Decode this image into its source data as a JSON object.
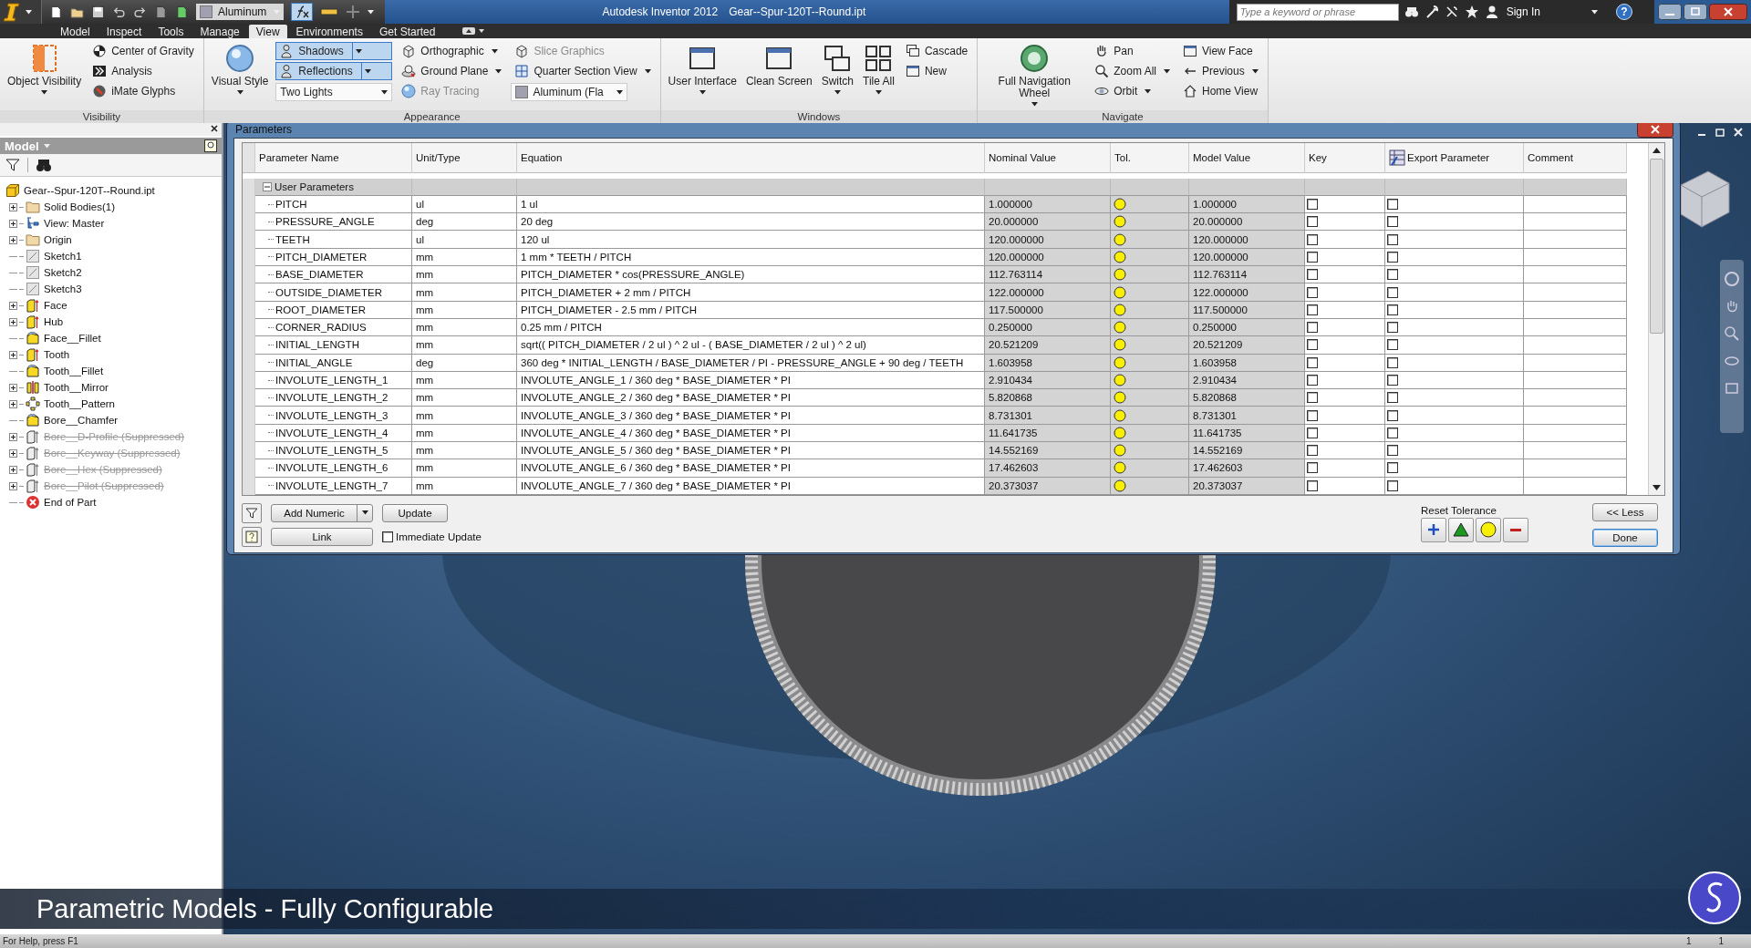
{
  "title_bar": {
    "product": "Autodesk Inventor 2012",
    "file": "Gear--Spur-120T--Round.ipt",
    "material": "Aluminum",
    "search_placeholder": "Type a keyword or phrase",
    "sign_in": "Sign In",
    "help": "?"
  },
  "ribbon_tabs": [
    {
      "label": "Model",
      "selected": false
    },
    {
      "label": "Inspect",
      "selected": false
    },
    {
      "label": "Tools",
      "selected": false
    },
    {
      "label": "Manage",
      "selected": false
    },
    {
      "label": "View",
      "selected": true
    },
    {
      "label": "Environments",
      "selected": false
    },
    {
      "label": "Get Started",
      "selected": false
    }
  ],
  "ribbon_panels": [
    {
      "title": "Visibility",
      "columns": [
        [
          {
            "label": "Object Visibility",
            "kind": "large",
            "menu": true,
            "disabled": false
          }
        ],
        [
          {
            "label": "Center of Gravity",
            "kind": "small",
            "menu": false,
            "disabled": false
          },
          {
            "label": "Analysis",
            "kind": "small",
            "menu": false,
            "disabled": false
          },
          {
            "label": "iMate Glyphs",
            "kind": "small",
            "menu": false,
            "disabled": false
          }
        ]
      ]
    },
    {
      "title": "Appearance",
      "columns": [
        [
          {
            "label": "Visual Style",
            "kind": "large",
            "menu": true,
            "disabled": false
          }
        ],
        [
          {
            "label": "Shadows",
            "kind": "toggle",
            "on": true,
            "menu": true,
            "disabled": false
          },
          {
            "label": "Reflections",
            "kind": "toggle",
            "on": true,
            "menu": true,
            "disabled": false
          },
          {
            "label": "Two Lights",
            "kind": "select",
            "menu": true,
            "disabled": false
          }
        ],
        [
          {
            "label": "Orthographic",
            "kind": "small",
            "menu": true,
            "disabled": false
          },
          {
            "label": "Ground Plane",
            "kind": "small",
            "menu": true,
            "disabled": false
          },
          {
            "label": "Ray Tracing",
            "kind": "small",
            "menu": false,
            "disabled": true
          }
        ],
        [
          {
            "label": "Slice Graphics",
            "kind": "small",
            "menu": false,
            "disabled": true
          },
          {
            "label": "Quarter Section View",
            "kind": "small",
            "menu": true,
            "disabled": false
          },
          {
            "label": "Aluminum (Fla",
            "kind": "select",
            "menu": true,
            "disabled": false
          }
        ]
      ]
    },
    {
      "title": "Windows",
      "columns": [
        [
          {
            "label": "User Interface",
            "kind": "large",
            "menu": true,
            "disabled": false
          }
        ],
        [
          {
            "label": "Clean Screen",
            "kind": "large",
            "menu": false,
            "disabled": false
          }
        ],
        [
          {
            "label": "Switch",
            "kind": "large",
            "menu": true,
            "disabled": false
          }
        ],
        [
          {
            "label": "Tile All",
            "kind": "large",
            "menu": true,
            "disabled": false
          }
        ],
        [
          {
            "label": "Cascade",
            "kind": "small",
            "menu": false,
            "disabled": false
          },
          {
            "label": "New",
            "kind": "small",
            "menu": false,
            "disabled": false
          }
        ]
      ]
    },
    {
      "title": "Navigate",
      "columns": [
        [
          {
            "label": "Full Navigation Wheel",
            "kind": "large",
            "menu": true,
            "disabled": false
          }
        ],
        [
          {
            "label": "Pan",
            "kind": "small",
            "menu": false,
            "disabled": false
          },
          {
            "label": "Zoom All",
            "kind": "small",
            "menu": true,
            "disabled": false
          },
          {
            "label": "Orbit",
            "kind": "small",
            "menu": true,
            "disabled": false
          }
        ],
        [
          {
            "label": "View Face",
            "kind": "small",
            "menu": false,
            "disabled": false
          },
          {
            "label": "Previous",
            "kind": "small",
            "menu": true,
            "disabled": false
          },
          {
            "label": "Home View",
            "kind": "small",
            "menu": false,
            "disabled": false
          }
        ]
      ]
    }
  ],
  "browser": {
    "title": "Model",
    "tree": [
      {
        "label": "Gear--Spur-120T--Round.ipt",
        "kind": "part",
        "suppressed": false,
        "children": [
          {
            "label": "Solid Bodies(1)",
            "kind": "bodies",
            "expandable": true,
            "suppressed": false
          },
          {
            "label": "View: Master",
            "kind": "view",
            "expandable": true,
            "suppressed": false
          },
          {
            "label": "Origin",
            "kind": "folder",
            "expandable": true,
            "suppressed": false
          },
          {
            "label": "Sketch1",
            "kind": "sketch",
            "expandable": false,
            "suppressed": false
          },
          {
            "label": "Sketch2",
            "kind": "sketch",
            "expandable": false,
            "suppressed": false
          },
          {
            "label": "Sketch3",
            "kind": "sketch",
            "expandable": false,
            "suppressed": false
          },
          {
            "label": "Face",
            "kind": "extrude",
            "expandable": true,
            "suppressed": false
          },
          {
            "label": "Hub",
            "kind": "extrude",
            "expandable": true,
            "suppressed": false
          },
          {
            "label": "Face__Fillet",
            "kind": "fillet",
            "expandable": false,
            "suppressed": false
          },
          {
            "label": "Tooth",
            "kind": "extrude",
            "expandable": true,
            "suppressed": false
          },
          {
            "label": "Tooth__Fillet",
            "kind": "fillet",
            "expandable": false,
            "suppressed": false
          },
          {
            "label": "Tooth__Mirror",
            "kind": "mirror",
            "expandable": true,
            "suppressed": false
          },
          {
            "label": "Tooth__Pattern",
            "kind": "pattern",
            "expandable": true,
            "suppressed": false
          },
          {
            "label": "Bore__Chamfer",
            "kind": "fillet",
            "expandable": false,
            "suppressed": false
          },
          {
            "label": "Bore__D-Profile (Suppressed)",
            "kind": "extrude",
            "expandable": true,
            "suppressed": true
          },
          {
            "label": "Bore__Keyway (Suppressed)",
            "kind": "extrude",
            "expandable": true,
            "suppressed": true
          },
          {
            "label": "Bore__Hex (Suppressed)",
            "kind": "extrude",
            "expandable": true,
            "suppressed": true
          },
          {
            "label": "Bore__Pilot (Suppressed)",
            "kind": "extrude",
            "expandable": true,
            "suppressed": true
          },
          {
            "label": "End of Part",
            "kind": "end",
            "expandable": false,
            "suppressed": false
          }
        ]
      }
    ]
  },
  "parameters_dialog": {
    "title": "Parameters",
    "columns": [
      "Parameter Name",
      "Unit/Type",
      "Equation",
      "Nominal Value",
      "Tol.",
      "Model Value",
      "Key",
      "Export Parameter",
      "Comment"
    ],
    "group": {
      "label": "User Parameters",
      "expanded": true
    },
    "rows": [
      {
        "name": "PITCH",
        "unit": "ul",
        "equation": "1 ul",
        "nominal": "1.000000",
        "model": "1.000000",
        "key": false,
        "export": false
      },
      {
        "name": "PRESSURE_ANGLE",
        "unit": "deg",
        "equation": "20 deg",
        "nominal": "20.000000",
        "model": "20.000000",
        "key": false,
        "export": false
      },
      {
        "name": "TEETH",
        "unit": "ul",
        "equation": "120 ul",
        "nominal": "120.000000",
        "model": "120.000000",
        "key": false,
        "export": false
      },
      {
        "name": "PITCH_DIAMETER",
        "unit": "mm",
        "equation": "1 mm * TEETH / PITCH",
        "nominal": "120.000000",
        "model": "120.000000",
        "key": false,
        "export": false
      },
      {
        "name": "BASE_DIAMETER",
        "unit": "mm",
        "equation": "PITCH_DIAMETER * cos(PRESSURE_ANGLE)",
        "nominal": "112.763114",
        "model": "112.763114",
        "key": false,
        "export": false
      },
      {
        "name": "OUTSIDE_DIAMETER",
        "unit": "mm",
        "equation": "PITCH_DIAMETER + 2 mm / PITCH",
        "nominal": "122.000000",
        "model": "122.000000",
        "key": false,
        "export": false
      },
      {
        "name": "ROOT_DIAMETER",
        "unit": "mm",
        "equation": "PITCH_DIAMETER - 2.5 mm / PITCH",
        "nominal": "117.500000",
        "model": "117.500000",
        "key": false,
        "export": false
      },
      {
        "name": "CORNER_RADIUS",
        "unit": "mm",
        "equation": "0.25 mm / PITCH",
        "nominal": "0.250000",
        "model": "0.250000",
        "key": false,
        "export": false
      },
      {
        "name": "INITIAL_LENGTH",
        "unit": "mm",
        "equation": "sqrt(( PITCH_DIAMETER / 2 ul ) ^ 2 ul - ( BASE_DIAMETER / 2 ul ) ^ 2 ul)",
        "nominal": "20.521209",
        "model": "20.521209",
        "key": false,
        "export": false
      },
      {
        "name": "INITIAL_ANGLE",
        "unit": "deg",
        "equation": "360 deg * INITIAL_LENGTH / BASE_DIAMETER / PI - PRESSURE_ANGLE + 90 deg / TEETH",
        "nominal": "1.603958",
        "model": "1.603958",
        "key": false,
        "export": false
      },
      {
        "name": "INVOLUTE_LENGTH_1",
        "unit": "mm",
        "equation": "INVOLUTE_ANGLE_1 / 360 deg * BASE_DIAMETER * PI",
        "nominal": "2.910434",
        "model": "2.910434",
        "key": false,
        "export": false
      },
      {
        "name": "INVOLUTE_LENGTH_2",
        "unit": "mm",
        "equation": "INVOLUTE_ANGLE_2 / 360 deg * BASE_DIAMETER * PI",
        "nominal": "5.820868",
        "model": "5.820868",
        "key": false,
        "export": false
      },
      {
        "name": "INVOLUTE_LENGTH_3",
        "unit": "mm",
        "equation": "INVOLUTE_ANGLE_3 / 360 deg * BASE_DIAMETER * PI",
        "nominal": "8.731301",
        "model": "8.731301",
        "key": false,
        "export": false
      },
      {
        "name": "INVOLUTE_LENGTH_4",
        "unit": "mm",
        "equation": "INVOLUTE_ANGLE_4 / 360 deg * BASE_DIAMETER * PI",
        "nominal": "11.641735",
        "model": "11.641735",
        "key": false,
        "export": false
      },
      {
        "name": "INVOLUTE_LENGTH_5",
        "unit": "mm",
        "equation": "INVOLUTE_ANGLE_5 / 360 deg * BASE_DIAMETER * PI",
        "nominal": "14.552169",
        "model": "14.552169",
        "key": false,
        "export": false
      },
      {
        "name": "INVOLUTE_LENGTH_6",
        "unit": "mm",
        "equation": "INVOLUTE_ANGLE_6 / 360 deg * BASE_DIAMETER * PI",
        "nominal": "17.462603",
        "model": "17.462603",
        "key": false,
        "export": false
      },
      {
        "name": "INVOLUTE_LENGTH_7",
        "unit": "mm",
        "equation": "INVOLUTE_ANGLE_7 / 360 deg * BASE_DIAMETER * PI",
        "nominal": "20.373037",
        "model": "20.373037",
        "key": false,
        "export": false
      }
    ],
    "add_button": "Add Numeric",
    "update_button": "Update",
    "link_button": "Link",
    "immediate_update": {
      "label": "Immediate Update",
      "checked": false
    },
    "reset_tolerance": "Reset Tolerance",
    "less_button": "<< Less",
    "done_button": "Done"
  },
  "caption": "Parametric Models - Fully Configurable",
  "status_bar": {
    "help": "For Help, press F1",
    "count_1": "1",
    "count_2": "1"
  }
}
